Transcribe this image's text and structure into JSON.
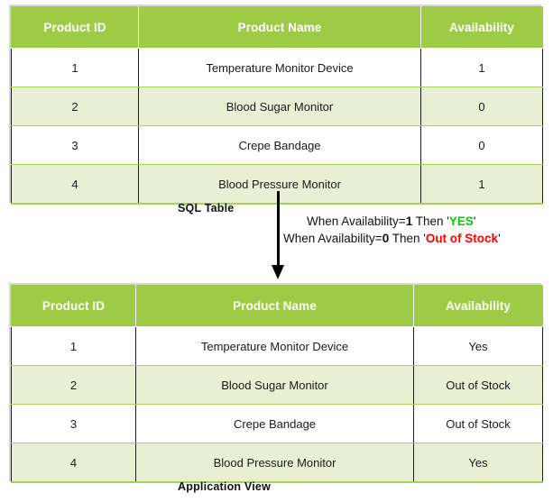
{
  "diagram": {
    "title_top": "SQL Table",
    "title_bottom": "Application View"
  },
  "sql_table": {
    "caption": "SQL Table",
    "columns": [
      "Product ID",
      "Product Name",
      "Availability"
    ],
    "rows": [
      {
        "product_id": "1",
        "product_name": "Temperature Monitor Device",
        "availability": "1"
      },
      {
        "product_id": "2",
        "product_name": "Blood Sugar Monitor",
        "availability": "0"
      },
      {
        "product_id": "3",
        "product_name": "Crepe Bandage",
        "availability": "0"
      },
      {
        "product_id": "4",
        "product_name": "Blood Pressure Monitor",
        "availability": "1"
      }
    ]
  },
  "app_table": {
    "caption": "Application View",
    "columns": [
      "Product ID",
      "Product Name",
      "Availability"
    ],
    "rows": [
      {
        "product_id": "1",
        "product_name": "Temperature Monitor Device",
        "availability": "Yes"
      },
      {
        "product_id": "2",
        "product_name": "Blood Sugar Monitor",
        "availability": "Out of Stock"
      },
      {
        "product_id": "3",
        "product_name": "Crepe Bandage",
        "availability": "Out of Stock"
      },
      {
        "product_id": "4",
        "product_name": "Blood Pressure Monitor",
        "availability": "Yes"
      }
    ]
  },
  "annotation": {
    "line1": {
      "prefix": "When Availability=",
      "value": "1",
      "middle": " Then '",
      "result": "YES",
      "suffix": "'"
    },
    "line2": {
      "prefix": "When Availability=",
      "value": "0",
      "middle": " Then '",
      "result": "Out of Stock",
      "suffix": "'"
    }
  },
  "colors": {
    "header_green": "#9ecb46",
    "row_alt": "#e9efd2",
    "row_base": "#ffffff",
    "border_green": "#a9cf5a",
    "yes_green": "#00cc00",
    "out_of_stock_red": "#fe0000",
    "arrow_black": "#000000"
  },
  "icons": {
    "arrow": "down-arrow-icon"
  }
}
